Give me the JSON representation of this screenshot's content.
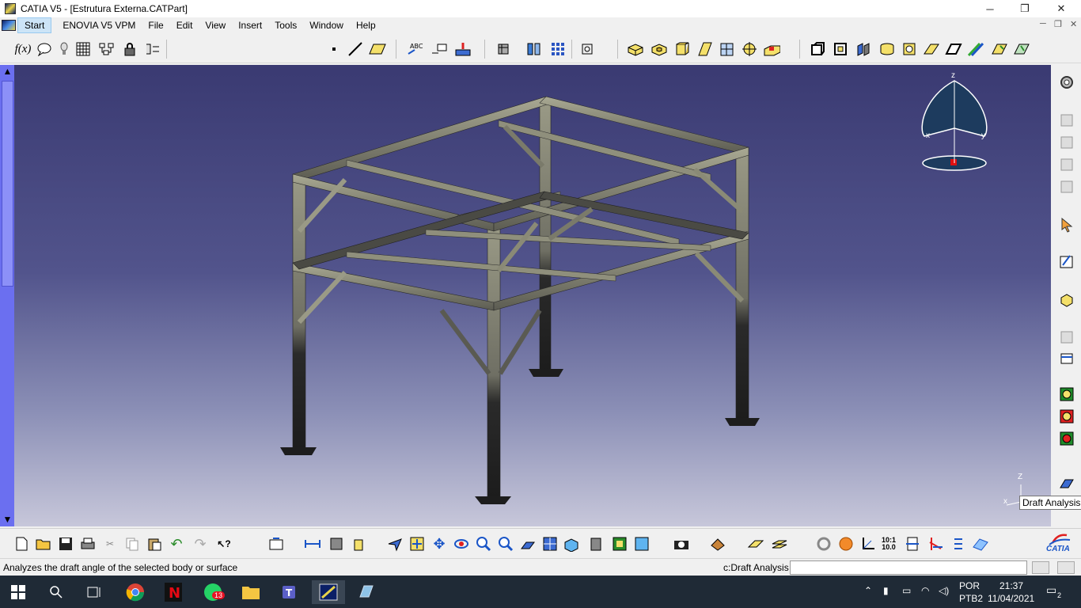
{
  "window": {
    "title": "CATIA V5 - [Estrutura Externa.CATPart]",
    "minimize_glyph": "─",
    "restore_glyph": "❐",
    "close_glyph": "✕"
  },
  "menu": {
    "items": [
      "Start",
      "ENOVIA V5 VPM",
      "File",
      "Edit",
      "View",
      "Insert",
      "Tools",
      "Window",
      "Help"
    ]
  },
  "viewport": {
    "compass_axes": {
      "z": "z",
      "x": "x",
      "y": "y"
    },
    "corner_axes": {
      "z": "Z",
      "x": "x"
    },
    "colors": {
      "background_top": "#3a3a72",
      "background_bottom": "#c7c7da",
      "steel": "#8f8f7c",
      "steel_dark": "#2a2a2a"
    }
  },
  "tooltip": {
    "text": "Draft Analysis"
  },
  "status": {
    "message": "Analyzes the draft angle of the selected body or surface",
    "command_label": "c:Draft Analysis",
    "command_value": ""
  },
  "logo": {
    "text": "CATIA"
  },
  "taskbar": {
    "whatsapp_badge": "13",
    "language": "POR",
    "layout": "PTB2",
    "time": "21:37",
    "date": "11/04/2021",
    "notifications": "2"
  },
  "icons": {
    "top_toolbar": [
      "formula-icon",
      "comment-icon",
      "light-icon",
      "table-icon",
      "design-table-icon",
      "lock-icon",
      "parameters-icon",
      "point-icon",
      "line-icon",
      "plane-icon",
      "text-annotation-icon",
      "flag-note-icon",
      "measure-icon",
      "axis-system-icon",
      "split-icon",
      "grid-icon",
      "snap-icon",
      "pad-icon",
      "pocket-icon",
      "shaft-icon",
      "rib-icon",
      "stiffener-icon",
      "hole-icon",
      "chamfer-icon",
      "boolean-icon",
      "insert-body-icon",
      "apply-material-icon",
      "catalog-icon",
      "cylinder-icon",
      "box-icon",
      "fillet-icon",
      "draft-icon",
      "thickness-icon",
      "shell-icon",
      "remove-face-icon"
    ],
    "bottom_toolbar": [
      "new-icon",
      "open-icon",
      "save-icon",
      "print-icon",
      "cut-icon",
      "copy-icon",
      "paste-icon",
      "undo-icon",
      "redo-icon",
      "whats-this-icon",
      "update-icon",
      "measure-between-icon",
      "measure-item-icon",
      "measure-inertia-icon",
      "fly-mode-icon",
      "fit-all-icon",
      "pan-icon",
      "rotate-icon",
      "zoom-in-icon",
      "zoom-out-icon",
      "normal-view-icon",
      "multi-view-icon",
      "iso-view-icon",
      "shading-icon",
      "hide-show-icon",
      "swap-space-icon",
      "capture-icon",
      "apply-material-icon",
      "sketch-analysis-icon",
      "layers-icon",
      "refresh-icon",
      "hand-icon",
      "axis-icon",
      "scale-icon",
      "sections-icon",
      "constraint-icon",
      "spec-tree-icon",
      "surface-icon"
    ],
    "right_toolbar": [
      "settings-icon",
      "publication-icon",
      "geometry-set-icon",
      "ordered-geometry-icon",
      "body-icon",
      "select-icon",
      "sketch-icon",
      "3d-annotation-icon",
      "view-icon",
      "plane-icon",
      "draft-analysis-icon",
      "curvature-icon",
      "distance-analysis-icon",
      "section-analysis-icon"
    ]
  }
}
